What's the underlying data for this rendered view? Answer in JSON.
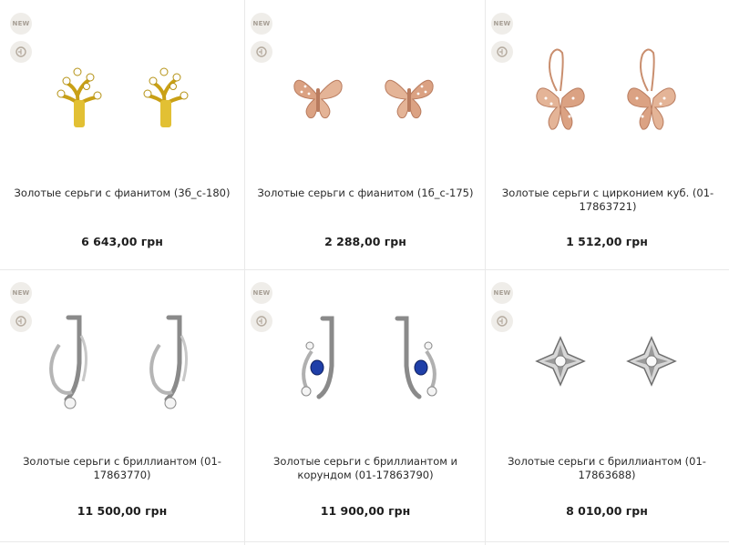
{
  "badges": {
    "new": "NEW",
    "icon": "gift-tag-icon"
  },
  "products": [
    {
      "title": "Золотые серьги с фианитом (3б_с-180)",
      "price": "6 643,00 грн",
      "image": "gold-tree-stud-earrings"
    },
    {
      "title": "Золотые серьги с фианитом (1б_с-175)",
      "price": "2 288,00 грн",
      "image": "rose-gold-butterfly-stud-earrings"
    },
    {
      "title": "Золотые серьги с цирконием куб. (01-17863721)",
      "price": "1 512,00 грн",
      "image": "rose-gold-butterfly-drop-earrings"
    },
    {
      "title": "Золотые серьги с бриллиантом (01-17863770)",
      "price": "11 500,00 грн",
      "image": "white-gold-hoop-diamond-earrings"
    },
    {
      "title": "Золотые серьги с бриллиантом и корундом (01-17863790)",
      "price": "11 900,00 грн",
      "image": "white-gold-sapphire-earrings"
    },
    {
      "title": "Золотые серьги с бриллиантом (01-17863688)",
      "price": "8 010,00 грн",
      "image": "white-gold-flower-stud-earrings"
    }
  ],
  "colors": {
    "border": "#e9e9e9",
    "badge_bg": "#efede9",
    "badge_text": "#a79f95",
    "gold": "#d9b21f",
    "rose_gold": "#d99f80",
    "white_gold": "#c9c9c9",
    "sapphire": "#1f3fa8"
  }
}
